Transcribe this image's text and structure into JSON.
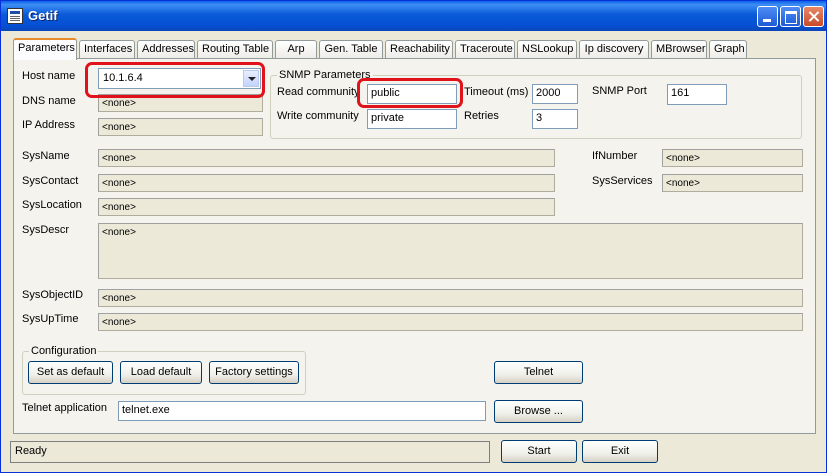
{
  "window": {
    "title": "Getif"
  },
  "tabs": [
    {
      "label": "Parameters"
    },
    {
      "label": "Interfaces"
    },
    {
      "label": "Addresses"
    },
    {
      "label": "Routing Table"
    },
    {
      "label": "Arp"
    },
    {
      "label": "Gen. Table"
    },
    {
      "label": "Reachability"
    },
    {
      "label": "Traceroute"
    },
    {
      "label": "NSLookup"
    },
    {
      "label": "Ip discovery"
    },
    {
      "label": "MBrowser"
    },
    {
      "label": "Graph"
    }
  ],
  "host": {
    "hostname_label": "Host name",
    "hostname_value": "10.1.6.4",
    "dns_label": "DNS name",
    "dns_value": "<none>",
    "ip_label": "IP Address",
    "ip_value": "<none>"
  },
  "snmp": {
    "group_label": "SNMP Parameters",
    "read_label": "Read community",
    "read_value": "public",
    "write_label": "Write community",
    "write_value": "private",
    "timeout_label": "Timeout (ms)",
    "timeout_value": "2000",
    "retries_label": "Retries",
    "retries_value": "3",
    "port_label": "SNMP Port",
    "port_value": "161"
  },
  "sys": {
    "name_label": "SysName",
    "name_value": "<none>",
    "contact_label": "SysContact",
    "contact_value": "<none>",
    "location_label": "SysLocation",
    "location_value": "<none>",
    "descr_label": "SysDescr",
    "descr_value": "<none>",
    "objectid_label": "SysObjectID",
    "objectid_value": "<none>",
    "uptime_label": "SysUpTime",
    "uptime_value": "<none>",
    "ifnumber_label": "IfNumber",
    "ifnumber_value": "<none>",
    "services_label": "SysServices",
    "services_value": "<none>"
  },
  "config": {
    "group_label": "Configuration",
    "set_default": "Set as default",
    "load_default": "Load default",
    "factory": "Factory settings"
  },
  "telnet": {
    "button": "Telnet",
    "app_label": "Telnet application",
    "app_value": "telnet.exe",
    "browse": "Browse ..."
  },
  "footer": {
    "status": "Ready",
    "start": "Start",
    "exit": "Exit"
  },
  "colors": {
    "highlight": "#E0121A",
    "titlebar": "#0A5AD8",
    "face": "#ECE9D8"
  }
}
